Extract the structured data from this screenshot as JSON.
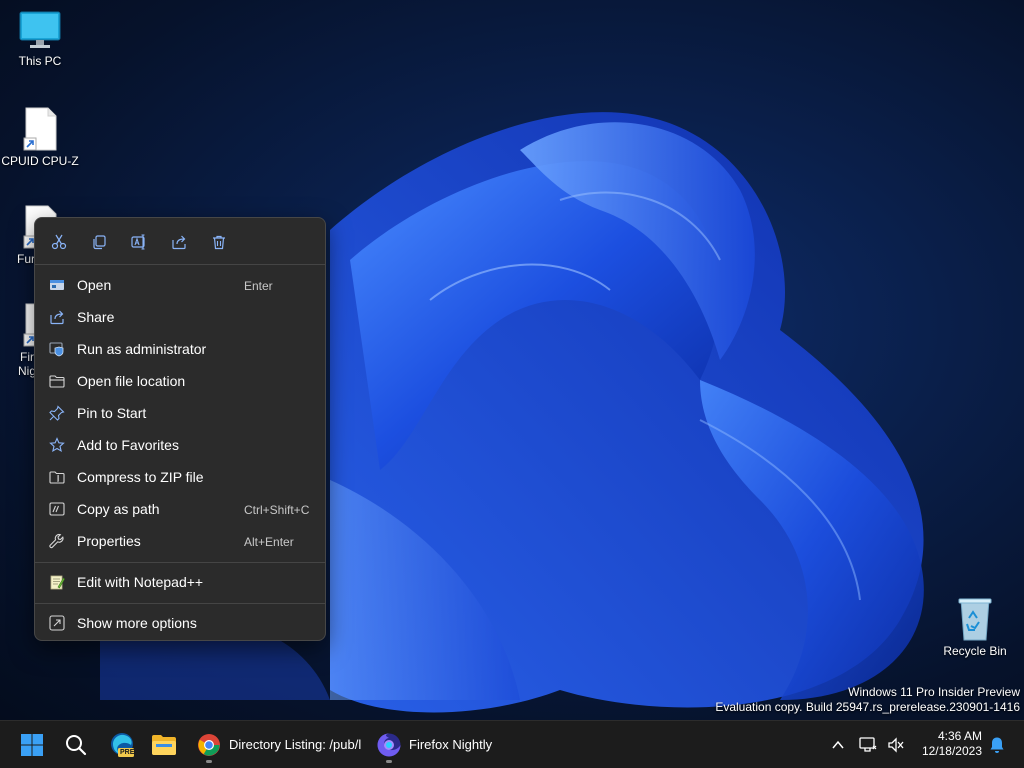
{
  "desktop": {
    "icons": [
      {
        "label": "This PC",
        "icon": "monitor-icon"
      },
      {
        "label": "CPUID CPU-Z",
        "icon": "shortcut-file-icon"
      },
      {
        "label": "Fur",
        "icon": "shortcut-file-icon"
      },
      {
        "label": "Fir",
        "label2": "Nig",
        "icon": "shortcut-file-icon"
      },
      {
        "label": "Recycle Bin",
        "icon": "recycle-bin-icon"
      }
    ],
    "watermark": {
      "line1": "Windows 11 Pro Insider Preview",
      "line2": "Evaluation copy. Build 25947.rs_prerelease.230901-1416"
    }
  },
  "context_menu": {
    "quick_actions": [
      {
        "name": "cut",
        "icon": "scissors-icon"
      },
      {
        "name": "copy",
        "icon": "copy-icon"
      },
      {
        "name": "rename",
        "icon": "rename-icon"
      },
      {
        "name": "share",
        "icon": "share-icon"
      },
      {
        "name": "delete",
        "icon": "trash-icon"
      }
    ],
    "items": [
      {
        "label": "Open",
        "shortcut": "Enter",
        "icon": "open-icon"
      },
      {
        "label": "Share",
        "shortcut": "",
        "icon": "share-icon"
      },
      {
        "label": "Run as administrator",
        "shortcut": "",
        "icon": "shield-icon"
      },
      {
        "label": "Open file location",
        "shortcut": "",
        "icon": "folder-icon"
      },
      {
        "label": "Pin to Start",
        "shortcut": "",
        "icon": "pin-icon"
      },
      {
        "label": "Add to Favorites",
        "shortcut": "",
        "icon": "star-icon"
      },
      {
        "label": "Compress to ZIP file",
        "shortcut": "",
        "icon": "zip-folder-icon"
      },
      {
        "label": "Copy as path",
        "shortcut": "Ctrl+Shift+C",
        "icon": "path-icon"
      },
      {
        "label": "Properties",
        "shortcut": "Alt+Enter",
        "icon": "wrench-icon"
      },
      {
        "label": "Edit with Notepad++",
        "shortcut": "",
        "icon": "notepad-icon"
      },
      {
        "label": "Show more options",
        "shortcut": "",
        "icon": "more-options-icon"
      }
    ]
  },
  "taskbar": {
    "start_icon": "windows-start-icon",
    "search_icon": "search-icon",
    "apps": [
      {
        "name": "edge-canary",
        "icon": "edge-pre-icon",
        "badge": "PRE"
      },
      {
        "name": "file-explorer",
        "icon": "folder-icon"
      },
      {
        "name": "chrome",
        "icon": "chrome-icon",
        "label": "Directory Listing: /pub/l"
      },
      {
        "name": "firefox-nightly",
        "icon": "firefox-nightly-icon",
        "label": "Firefox Nightly"
      }
    ],
    "tray": {
      "time": "4:36 AM",
      "date": "12/18/2023"
    }
  },
  "colors": {
    "menu_bg": "#2b2b2b",
    "taskbar_bg": "#1c1c1c",
    "accent": "#2f7cf6"
  }
}
